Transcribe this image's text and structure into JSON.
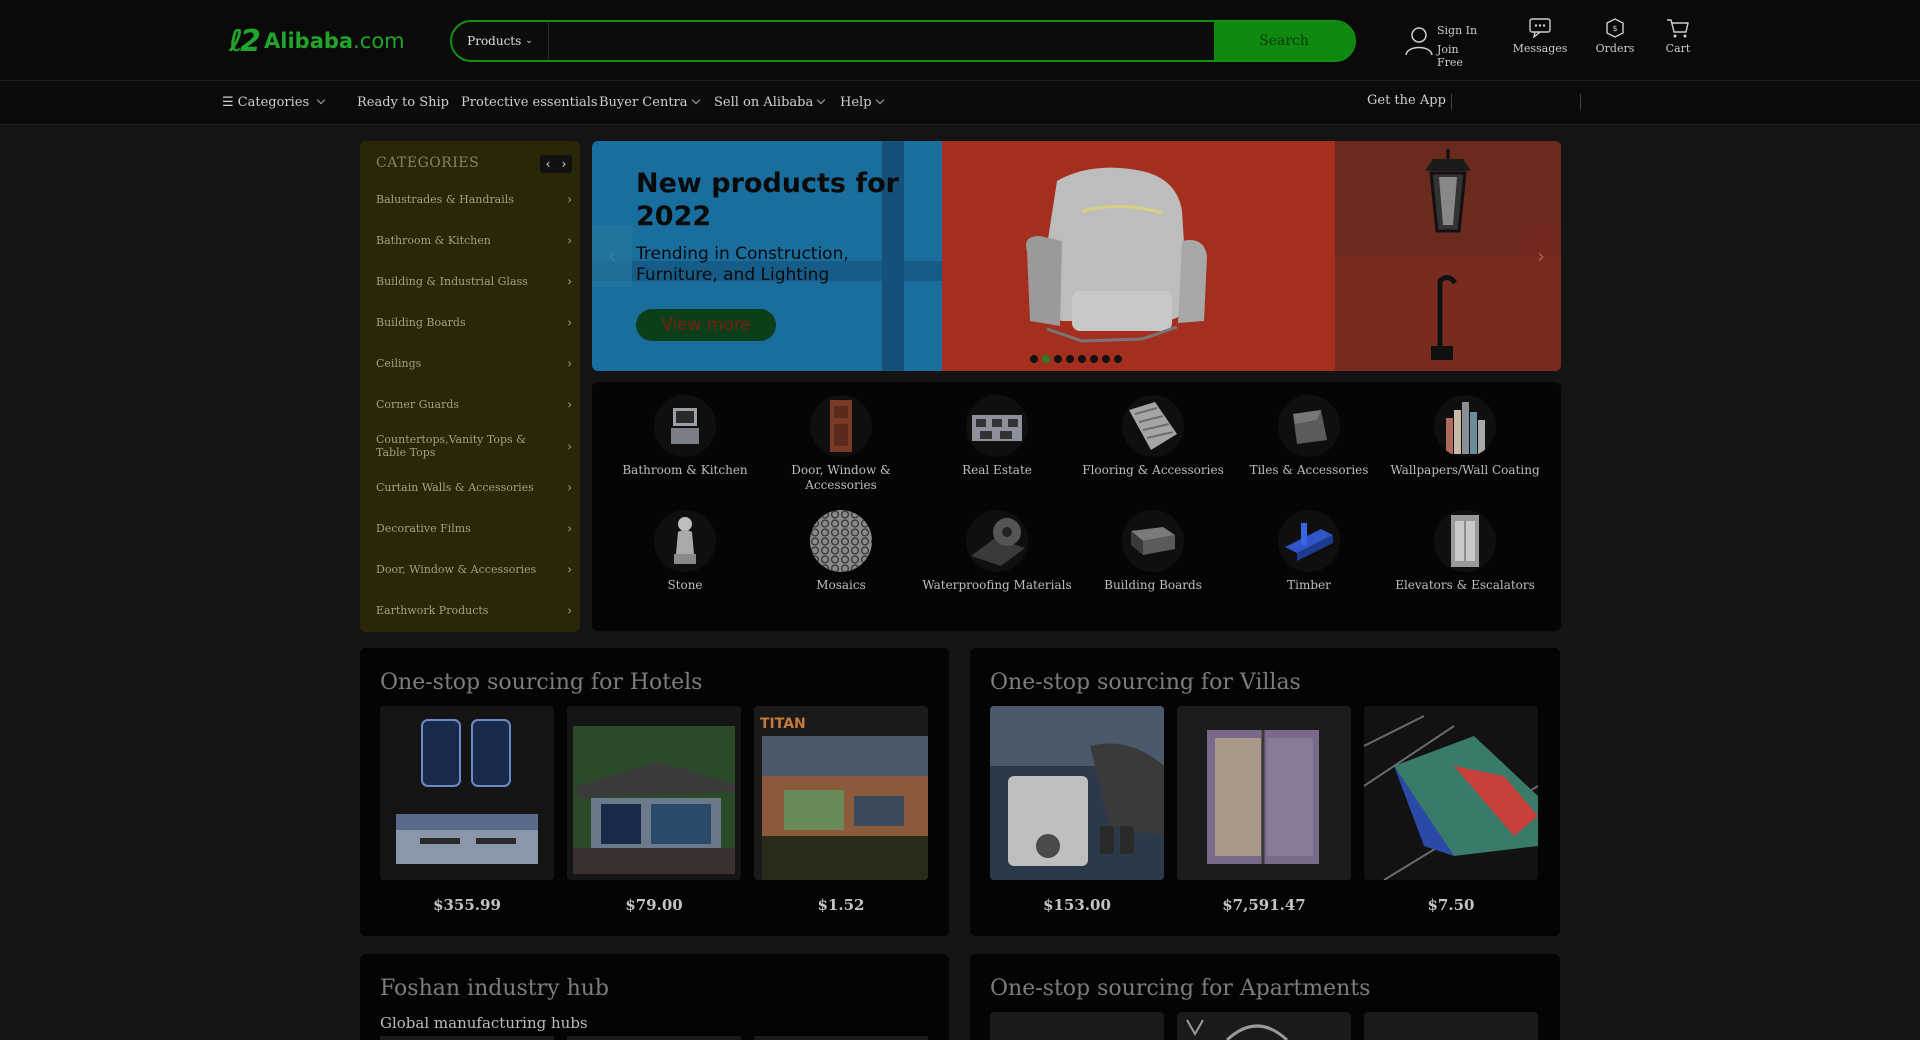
{
  "header": {
    "logo_mark": "ℓ2",
    "logo_text": "Alibaba",
    "logo_suffix": ".com",
    "search": {
      "category": "Products",
      "placeholder": "",
      "button": "Search"
    },
    "account": {
      "sign_in": "Sign In",
      "join": "Join Free"
    },
    "messages": "Messages",
    "orders": "Orders",
    "cart": "Cart"
  },
  "nav": {
    "categories": "Categories",
    "items": [
      "Ready to Ship",
      "Protective essentials",
      "Buyer Centra",
      "Sell on Alibaba",
      "Help"
    ],
    "get_app": "Get the App"
  },
  "sidebar": {
    "title": "CATEGORIES",
    "items": [
      "Balustrades & Handrails",
      "Bathroom & Kitchen",
      "Building & Industrial Glass",
      "Building Boards",
      "Ceilings",
      "Corner Guards",
      "Countertops,Vanity Tops & Table Tops",
      "Curtain Walls & Accessories",
      "Decorative Films",
      "Door, Window & Accessories",
      "Earthwork Products"
    ]
  },
  "banner": {
    "headline": "New products for 2022",
    "subline": "Trending in Construction, Furniture, and Lighting",
    "cta": "View more",
    "slide_count": 8,
    "active_slide": 2
  },
  "category_grid": [
    {
      "label": "Bathroom & Kitchen",
      "icon": "bathroom-kitchen-icon"
    },
    {
      "label": "Door, Window & Accessories",
      "icon": "door-icon"
    },
    {
      "label": "Real Estate",
      "icon": "real-estate-icon"
    },
    {
      "label": "Flooring & Accessories",
      "icon": "flooring-icon"
    },
    {
      "label": "Tiles & Accessories",
      "icon": "tiles-icon"
    },
    {
      "label": "Wallpapers/Wall Coating",
      "icon": "wallpaper-icon"
    },
    {
      "label": "Stone",
      "icon": "stone-icon"
    },
    {
      "label": "Mosaics",
      "icon": "mosaic-icon"
    },
    {
      "label": "Waterproofing Materials",
      "icon": "waterproofing-icon"
    },
    {
      "label": "Building Boards",
      "icon": "building-boards-icon"
    },
    {
      "label": "Timber",
      "icon": "timber-icon"
    },
    {
      "label": "Elevators & Escalators",
      "icon": "elevator-icon"
    }
  ],
  "sections": {
    "hotels": {
      "title": "One-stop sourcing for Hotels",
      "prices": [
        "$355.99",
        "$79.00",
        "$1.52"
      ],
      "brand_label": "TITAN"
    },
    "villas": {
      "title": "One-stop sourcing for Villas",
      "prices": [
        "$153.00",
        "$7,591.47",
        "$7.50"
      ]
    },
    "foshan": {
      "title": "Foshan industry hub",
      "subtitle": "Global manufacturing hubs"
    },
    "apartments": {
      "title": "One-stop sourcing for Apartments"
    }
  },
  "colors": {
    "brand_green": "#22a42a",
    "search_button": "#0f8a0f",
    "background": "#141414",
    "sidebar_bg": "#2a2608",
    "banner_blue": "#1a6e9e",
    "banner_red": "#a52f1e"
  }
}
